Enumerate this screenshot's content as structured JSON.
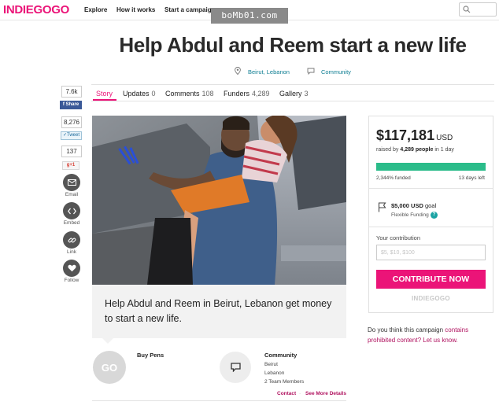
{
  "nav": {
    "logo": "INDIEGOGO",
    "links": [
      "Explore",
      "How it works",
      "Start a campaign"
    ],
    "search_placeholder": ""
  },
  "watermark": "boMb01.com",
  "campaign": {
    "title": "Help Abdul and Reem start a new life",
    "location": "Beirut, Lebanon",
    "category": "Community"
  },
  "tabs": [
    {
      "label": "Story",
      "count": ""
    },
    {
      "label": "Updates",
      "count": "0"
    },
    {
      "label": "Comments",
      "count": "108"
    },
    {
      "label": "Funders",
      "count": "4,289"
    },
    {
      "label": "Gallery",
      "count": "3"
    }
  ],
  "social": {
    "fb_count": "7.6k",
    "fb_share": "Share",
    "tw_count": "8,276",
    "tw_tweet": "Tweet",
    "gplus_count": "137",
    "gplus_label": "g+1",
    "email": "Email",
    "embed": "Embed",
    "link": "Link",
    "follow": "Follow"
  },
  "pitch": "Help Abdul and Reem in Beirut, Lebanon get money to start a new life.",
  "owner": {
    "name": "Buy Pens",
    "avatar_text": "GO",
    "category": "Community",
    "city": "Beirut",
    "country": "Lebanon",
    "team": "2 Team Members",
    "contact": "Contact",
    "sep": "·",
    "more": "See More Details"
  },
  "funding": {
    "amount": "$117,181",
    "currency": "USD",
    "raised_prefix": "raised by",
    "raised_people": "4,289 people",
    "raised_suffix": "in 1 day",
    "progress_fraction": 1.0,
    "funded": "2,344% funded",
    "days_left": "13 days left",
    "goal_amount": "$5,000 USD",
    "goal_word": "goal",
    "flexible": "Flexible Funding",
    "help": "?",
    "contribution_label": "Your contribution",
    "contribution_placeholder": "$5, $10, $100",
    "contribute_button": "CONTRIBUTE NOW",
    "brand": "INDIEGOGO"
  },
  "report": {
    "prefix": "Do you think this campaign",
    "link1": "contains prohibited content?",
    "link2": "Let us know."
  },
  "colors": {
    "brand_pink": "#eb1478",
    "teal_link": "#0e7e93",
    "progress_green": "#2bbc8a"
  }
}
